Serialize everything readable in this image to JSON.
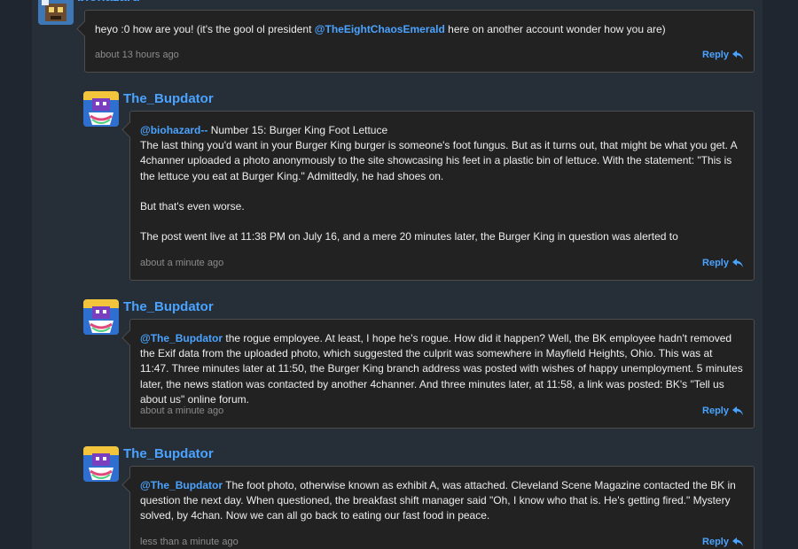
{
  "comments": [
    {
      "username": "biohazard",
      "avatar_icon": "avatar-biohazard",
      "mention": "@TheEightChaosEmerald",
      "text_before": "heyo :0 how are you! (it's the gool ol president ",
      "text_after": " here on another account wonder how you are)",
      "timestamp": "about 13 hours ago",
      "reply_label": "Reply"
    },
    {
      "username": "The_Bupdator",
      "avatar_icon": "avatar-bupdator",
      "mention": "@biohazard--",
      "paragraphs": [
        " Number 15: Burger King Foot Lettuce\nThe last thing you'd want in your Burger King burger is someone's foot fungus. But as it turns out, that might be what you get. A 4channer uploaded a photo anonymously to the site showcasing his feet in a plastic bin of lettuce. With the statement: \"This is the lettuce you eat at Burger King.\" Admittedly, he had shoes on.",
        "But that's even worse.",
        "The post went live at 11:38 PM on July 16, and a mere 20 minutes later, the Burger King in question was alerted to"
      ],
      "timestamp": "about a minute ago",
      "reply_label": "Reply"
    },
    {
      "username": "The_Bupdator",
      "avatar_icon": "avatar-bupdator",
      "mention": "@The_Bupdator",
      "text": " the rogue employee. At least, I hope he's rogue. How did it happen? Well, the BK employee hadn't removed the Exif data from the uploaded photo, which suggested the culprit was somewhere in Mayfield Heights, Ohio. This was at 11:47. Three minutes later at 11:50, the Burger King branch address was posted with wishes of happy unemployment. 5 minutes later, the news station was contacted by another 4channer. And three minutes later, at 11:58, a link was posted: BK's \"Tell us about us\" online forum.",
      "timestamp": "about a minute ago",
      "reply_label": "Reply"
    },
    {
      "username": "The_Bupdator",
      "avatar_icon": "avatar-bupdator",
      "mention": "@The_Bupdator",
      "text": " The foot photo, otherwise known as exhibit A, was attached. Cleveland Scene Magazine contacted the BK in question the next day. When questioned, the breakfast shift manager said \"Oh, I know who that is. He's getting fired.\" Mystery solved, by 4chan. Now we can all go back to eating our fast food in peace.",
      "timestamp": "less than a minute ago",
      "reply_label": "Reply"
    }
  ],
  "colors": {
    "link": "#4aa3ff",
    "bubble_bg": "#222222",
    "bubble_border": "#4d4d4d",
    "page_bg": "#262e38",
    "outer_bg": "#1f2630",
    "timestamp": "#8c8c8c"
  },
  "icons": {
    "reply": "reply-arrow-icon"
  }
}
